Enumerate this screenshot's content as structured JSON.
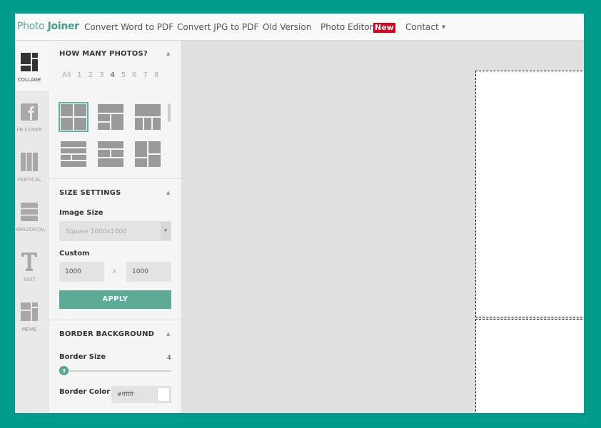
{
  "nav": {
    "brand_photo": "Photo",
    "brand_joiner": "Joiner",
    "links": [
      "Convert Word to PDF",
      "Convert JPG to PDF",
      "Old Version",
      "Photo Editor",
      "Contact"
    ],
    "new_badge": "New"
  },
  "rail": {
    "items": [
      {
        "label": "COLLAGE",
        "icon": "collage-icon"
      },
      {
        "label": "FB COVER",
        "icon": "facebook-icon"
      },
      {
        "label": "VERTICAL",
        "icon": "vertical-icon"
      },
      {
        "label": "HORIZONTAL",
        "icon": "horizontal-icon"
      },
      {
        "label": "TEXT",
        "icon": "text-icon"
      },
      {
        "label": "MEME",
        "icon": "meme-icon"
      }
    ]
  },
  "panel": {
    "how_many": {
      "title": "HOW MANY PHOTOS?",
      "counts": [
        "All",
        "1",
        "2",
        "3",
        "4",
        "5",
        "6",
        "7",
        "8"
      ],
      "selected": "4"
    },
    "size": {
      "title": "SIZE SETTINGS",
      "image_size_label": "Image Size",
      "image_size_value": "Square 1000x1000",
      "custom_label": "Custom",
      "width": "1000",
      "height": "1000",
      "separator": "x",
      "apply_label": "APPLY"
    },
    "border": {
      "title": "BORDER BACKGROUND",
      "size_label": "Border Size",
      "size_value": "4",
      "color_label": "Border Color",
      "color_value": "#ffffff"
    }
  },
  "colors": {
    "frame": "#009c8c",
    "accent": "#5bab96",
    "badge": "#d6001c"
  }
}
